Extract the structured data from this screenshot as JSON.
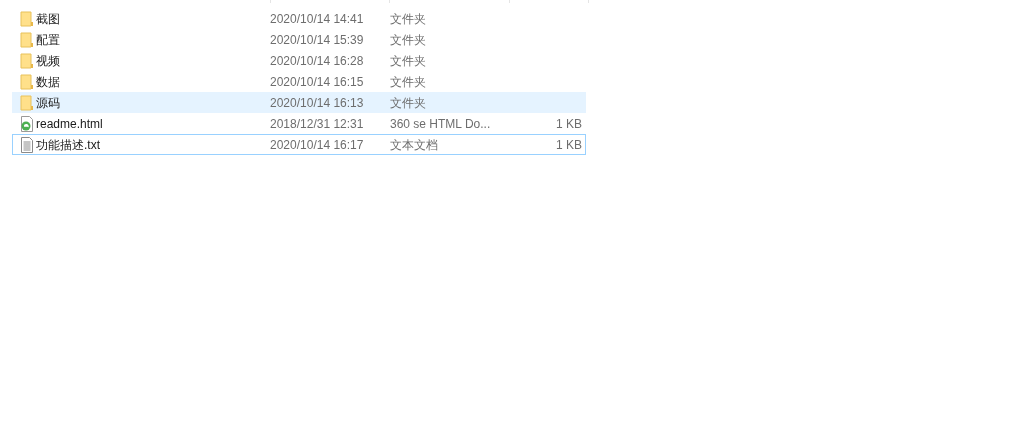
{
  "files": [
    {
      "kind": "folder",
      "name": "截图",
      "modified": "2020/10/14 14:41",
      "type": "文件夹",
      "hovered": false,
      "focused": false
    },
    {
      "kind": "folder",
      "name": "配置",
      "modified": "2020/10/14 15:39",
      "type": "文件夹",
      "hovered": false,
      "focused": false
    },
    {
      "kind": "folder",
      "name": "视频",
      "modified": "2020/10/14 16:28",
      "type": "文件夹",
      "hovered": false,
      "focused": false
    },
    {
      "kind": "folder",
      "name": "数据",
      "modified": "2020/10/14 16:15",
      "type": "文件夹",
      "hovered": false,
      "focused": false
    },
    {
      "kind": "folder",
      "name": "源码",
      "modified": "2020/10/14 16:13",
      "type": "文件夹",
      "hovered": true,
      "focused": false
    },
    {
      "kind": "html",
      "name": "readme.html",
      "modified": "2018/12/31 12:31",
      "type": "360 se HTML Do...",
      "size": "1 KB",
      "hovered": false,
      "focused": false
    },
    {
      "kind": "text",
      "name": "功能描述.txt",
      "modified": "2020/10/14 16:17",
      "type": "文本文档",
      "size": "1 KB",
      "hovered": false,
      "focused": true
    }
  ]
}
